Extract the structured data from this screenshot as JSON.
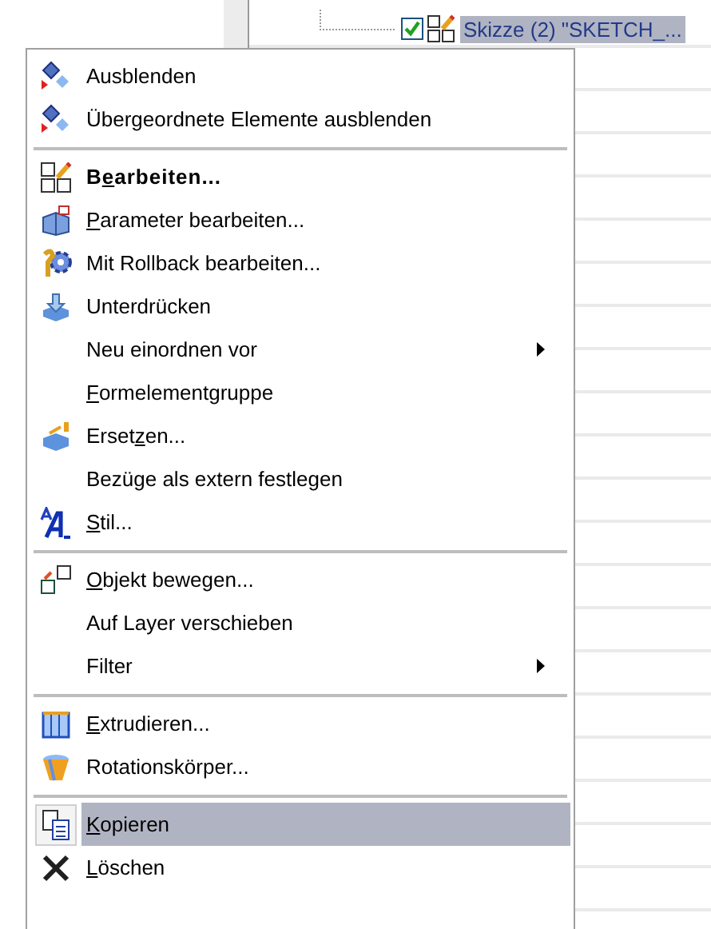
{
  "tree": {
    "rows": [
      {
        "label": "Skizze (2) \"SKETCH_...",
        "checked": true,
        "selected": true
      }
    ]
  },
  "context_menu": {
    "items": [
      {
        "kind": "item",
        "label": "Ausblenden",
        "bold": false,
        "submenu": false,
        "selected": false
      },
      {
        "kind": "item",
        "label": "Übergeordnete Elemente ausblenden",
        "bold": false,
        "submenu": false,
        "selected": false
      },
      {
        "kind": "separator"
      },
      {
        "kind": "item",
        "label_before": "B",
        "mnemonic": "e",
        "label_after": "arbeiten...",
        "bold": true,
        "submenu": false,
        "selected": false
      },
      {
        "kind": "item",
        "mnemonic": "P",
        "label_after": "arameter bearbeiten...",
        "bold": false,
        "submenu": false,
        "selected": false
      },
      {
        "kind": "item",
        "label": "Mit Rollback bearbeiten...",
        "bold": false,
        "submenu": false,
        "selected": false
      },
      {
        "kind": "item",
        "label": "Unterdrücken",
        "bold": false,
        "submenu": false,
        "selected": false
      },
      {
        "kind": "item",
        "label": "Neu einordnen vor",
        "bold": false,
        "submenu": true,
        "selected": false
      },
      {
        "kind": "item",
        "mnemonic": "F",
        "label_after": "ormelementgruppe",
        "bold": false,
        "submenu": false,
        "selected": false
      },
      {
        "kind": "item",
        "label_before": "Erset",
        "mnemonic": "z",
        "label_after": "en...",
        "bold": false,
        "submenu": false,
        "selected": false
      },
      {
        "kind": "item",
        "label": "Bezüge als extern festlegen",
        "bold": false,
        "submenu": false,
        "selected": false
      },
      {
        "kind": "item",
        "mnemonic": "S",
        "label_after": "til...",
        "bold": false,
        "submenu": false,
        "selected": false
      },
      {
        "kind": "separator"
      },
      {
        "kind": "item",
        "mnemonic": "O",
        "label_after": "bjekt bewegen...",
        "bold": false,
        "submenu": false,
        "selected": false
      },
      {
        "kind": "item",
        "label": "Auf Layer verschieben",
        "bold": false,
        "submenu": false,
        "selected": false
      },
      {
        "kind": "item",
        "label": "Filter",
        "bold": false,
        "submenu": true,
        "selected": false
      },
      {
        "kind": "separator"
      },
      {
        "kind": "item",
        "mnemonic": "E",
        "label_after": "xtrudieren...",
        "bold": false,
        "submenu": false,
        "selected": false
      },
      {
        "kind": "item",
        "label": "Rotationskörper...",
        "bold": false,
        "submenu": false,
        "selected": false
      },
      {
        "kind": "separator"
      },
      {
        "kind": "item",
        "mnemonic": "K",
        "label_after": "opieren",
        "bold": false,
        "submenu": false,
        "selected": true
      },
      {
        "kind": "item",
        "mnemonic": "L",
        "label_after": "öschen",
        "bold": false,
        "submenu": false,
        "selected": false
      }
    ]
  }
}
